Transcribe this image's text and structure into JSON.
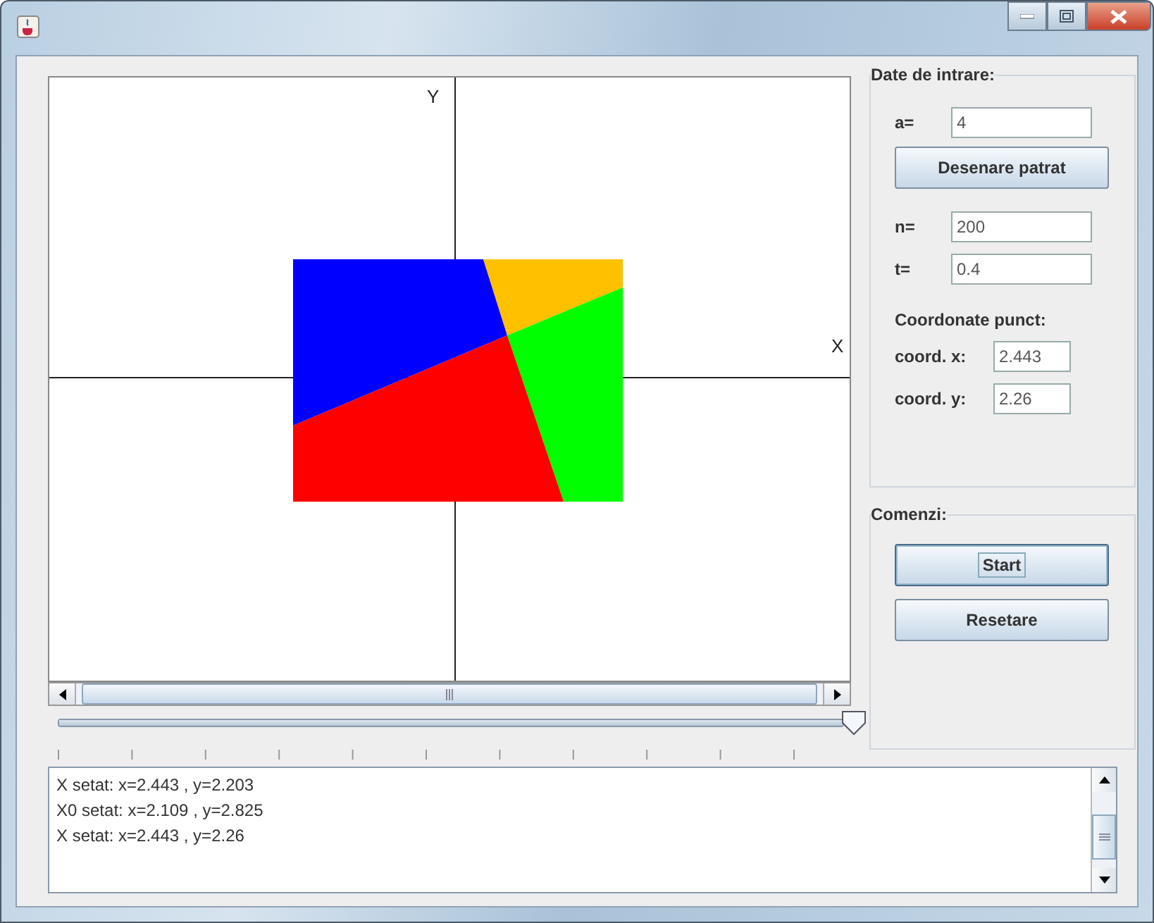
{
  "canvas": {
    "y_axis_label": "Y",
    "x_axis_label": "X",
    "regions": [
      {
        "color": "#0000ff"
      },
      {
        "color": "#ffc000"
      },
      {
        "color": "#00ff00"
      },
      {
        "color": "#ff0000"
      }
    ]
  },
  "slider": {
    "level": 1
  },
  "log": {
    "lines": [
      "X setat: x=2.443 , y=2.203",
      "X0 setat: x=2.109 , y=2.825",
      "X setat: x=2.443 , y=2.26"
    ]
  },
  "input_group": {
    "title": "Date de intrare:",
    "a_label": "a=",
    "a_value": "4",
    "draw_button": "Desenare patrat",
    "n_label": "n=",
    "n_value": "200",
    "t_label": "t=",
    "t_value": "0.4",
    "point_title": "Coordonate punct:",
    "x_label": "coord. x:",
    "x_value": "2.443",
    "y_label": "coord. y:",
    "y_value": "2.26"
  },
  "commands_group": {
    "title": "Comenzi:",
    "buttons": [
      {
        "label": "Start",
        "focused": true
      },
      {
        "label": "Resetare",
        "focused": false
      }
    ]
  }
}
